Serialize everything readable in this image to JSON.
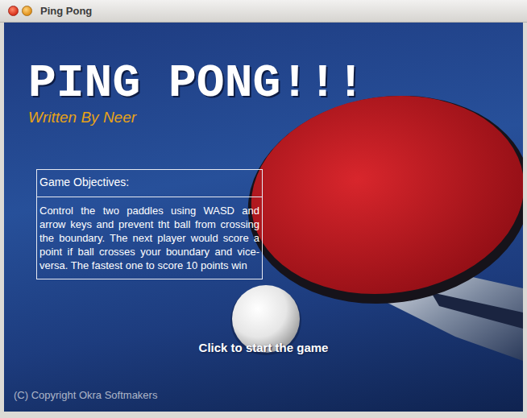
{
  "window": {
    "title": "Ping Pong"
  },
  "title": "PING PONG!!!",
  "subtitle": "Written By Neer",
  "objectives": {
    "heading": "Game Objectives:",
    "text": "Control the two paddles using WASD and arrow keys and prevent tht ball from crossing the boundary. The next player would score a point if ball crosses your boundary and vice-versa. The fastest one to score 10 points win"
  },
  "start": "Click to start the game",
  "copyright": "(C) Copyright Okra Softmakers"
}
